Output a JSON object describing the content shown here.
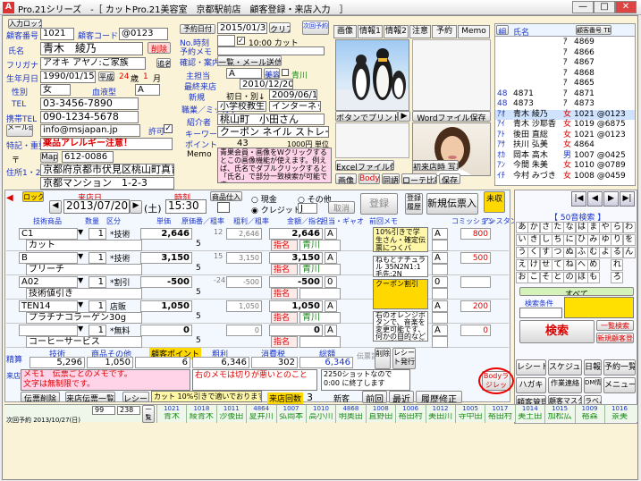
{
  "window": {
    "title": "Pro.21シリーズ　-［ カットPro.21美容室　京都駅前店　顧客登録・来店入力　］",
    "min": "—",
    "max": "□",
    "close": "✕"
  },
  "customer": {
    "lock": "入力ロック",
    "id_label": "顧客番号",
    "id": "1021",
    "code_label": "顧客コード",
    "code": "@0123",
    "name_label": "氏名",
    "name": "青木　綾乃",
    "delete": "削除",
    "furigana_label": "フリガナ",
    "furigana": "アオキ アヤノ:ご家族",
    "rename": "追名",
    "birth_label": "生年月日",
    "birth": "1990/01/15",
    "wareki": "平成",
    "age": "24",
    "age_unit": "歳",
    "month": "1",
    "month_unit": "月",
    "gender_label": "性別",
    "gender": "女",
    "blood_label": "血液型",
    "blood": "A",
    "tel_label": "TEL",
    "tel": "03-3456-7890",
    "mobile_label": "携帯TEL",
    "mobile": "090-1234-5678",
    "mail_label": "メール送信",
    "mail": "info@msjapan.jp",
    "permit": "許可",
    "note_label": "特記・重要",
    "note": "薬品アレルギー注意！",
    "zip_label": "〒",
    "map": "Map",
    "zip": "612-0086",
    "address_label": "住所1・2",
    "address1": "京都府京都市伏見区桃山町真育",
    "address2": "京都マンション　1-2-3"
  },
  "mid": {
    "reserve_label": "予約日付",
    "reserve_date": "2015/01/31",
    "clear": "クリア",
    "next_label": "次回予約",
    "next_reserve": "10:00 カット",
    "time_label": "No.時刻",
    "memo_label": "予約メモ",
    "confirm_label": "確認・案内",
    "confirm_btn": "一覧・メール送信",
    "staff_label": "主担当",
    "staff": "A",
    "staff_tag": "美容",
    "staff_name": "青川",
    "first_label": "最終来店",
    "first_date": "2010/12/20",
    "new_label": "新規",
    "first_visit": "初日・別↓",
    "first_visit_date": "2009/06/10",
    "job_label": "職業／ミッカケ",
    "job": "小学校教生",
    "route": "インターネット",
    "intro_label": "紹介者",
    "intro": "桃山町　小田さん",
    "keyword_label": "キーワード",
    "keyword": "クーポン ネイル ストレート",
    "point_label": "ポイント",
    "point": "43",
    "point_value": "1000円 単位",
    "memo_title": "Memo",
    "memo": "青果会員・画像をWクリックするとこの画像機能が使えます。例えば、氏名でダブルクリックすると「氏名」で部分一致検索が可能です"
  },
  "photos": {
    "tabs": [
      "画像",
      "情報1",
      "情報2",
      "注意",
      "予約",
      "Memo"
    ],
    "print_btn": "ボタンでプリント",
    "word_btn": "Wordファイル保存",
    "excel_btn": "Excelファイル保存",
    "shot_btn": "初来店時 写真",
    "image_btns": [
      "画像",
      "Body",
      "同語",
      "ローテ比較",
      "保存"
    ]
  },
  "list": {
    "header": [
      "組",
      "氏名",
      "顧客番号 TEL"
    ],
    "rows": [
      {
        "no": "",
        "name": "",
        "kana": "ｱ",
        "num": "4869"
      },
      {
        "no": "",
        "name": "",
        "kana": "ｱ",
        "num": "4866"
      },
      {
        "no": "",
        "name": "",
        "kana": "ｱ",
        "num": "4867"
      },
      {
        "no": "",
        "name": "",
        "kana": "ｱ",
        "num": "4868"
      },
      {
        "no": "",
        "name": "",
        "kana": "ｱ",
        "num": "4865"
      },
      {
        "no": "48",
        "name": "4871",
        "kana": "ｱ",
        "num": "4871"
      },
      {
        "no": "48",
        "name": "4873",
        "kana": "ｱ",
        "num": "4873"
      },
      {
        "no": "ｱｵ",
        "name": "青木 綾乃",
        "kana": "女",
        "num": "1021 @0123"
      },
      {
        "no": "ｱｲ",
        "name": "青木 沙耶香",
        "kana": "女",
        "num": "1019 @6875"
      },
      {
        "no": "ｱﾄ",
        "name": "後田 直総",
        "kana": "女",
        "num": "1021 @0123"
      },
      {
        "no": "ｱｻ",
        "name": "扶川 弘美",
        "kana": "女",
        "num": "4864"
      },
      {
        "no": "ｵｶ",
        "name": "岡本 高木",
        "kana": "男",
        "num": "1007 @0425"
      },
      {
        "no": "ｱﾝ",
        "name": "今間 朱美",
        "kana": "女",
        "num": "1010 @0789"
      },
      {
        "no": "ｲﾁ",
        "name": "今村 みづき",
        "kana": "女",
        "num": "1008 @0459"
      }
    ]
  },
  "visit": {
    "lock": "ロック中",
    "visit_label": "来店日",
    "date": "2013/07/20",
    "weekday": "(土)",
    "time_label": "時刻",
    "time": "15:30",
    "item_label": "商品仕入",
    "cash": "現金",
    "credit": "クレジット",
    "other": "その他",
    "other_val": "J",
    "cancel": "取消",
    "register": "登録",
    "history": "登録履歴",
    "new_slip": "新規伝票入力",
    "unpaid": "未収",
    "cols": [
      "技術商品",
      "数量",
      "区分",
      "単価",
      "原価番／粗率",
      "粗利／粗率",
      "金額／指名",
      "担当・ギャオ",
      "前回メモ",
      "コミッション",
      "アシスタント"
    ]
  },
  "lines": [
    {
      "code": "C1",
      "name": "カット",
      "qty": "1",
      "kind": "*技術",
      "price": "2,646",
      "cost": "5",
      "profit": "2,646",
      "amount": "2,646",
      "shimei": "A",
      "staff": "青川",
      "sub": "12",
      "comm": "800"
    },
    {
      "code": "B",
      "name": "ブリーチ",
      "qty": "1",
      "kind": "*技術",
      "price": "3,150",
      "cost": "5",
      "profit": "3,150",
      "amount": "3,150",
      "shimei": "A",
      "staff": "青川",
      "sub": "15",
      "comm": "500"
    },
    {
      "code": "A02",
      "name": "技術値引き",
      "qty": "1",
      "kind": "*割引",
      "price": "-500",
      "cost": "5",
      "profit": "-500",
      "amount": "-500",
      "shimei": "0",
      "staff": "",
      "sub": "-24",
      "comm": ""
    },
    {
      "code": "TEN14",
      "name": "プラチナコラーゲン30g",
      "qty": "1",
      "kind": "店販",
      "price": "1,050",
      "cost": "5",
      "profit": "1,050",
      "amount": "1,050",
      "shimei": "A",
      "staff": "青川",
      "sub": "",
      "comm": "200"
    },
    {
      "code": "",
      "name": "コーヒーサービス",
      "qty": "1",
      "kind": "*無料",
      "price": "0",
      "cost": "5",
      "profit": "0",
      "amount": "0",
      "shimei": "A",
      "staff": "",
      "sub": "",
      "comm": "0"
    }
  ],
  "memos": {
    "m1": "10%引きで学生さん・確定伝票につくバ",
    "m2": "ねもとナチュラル 35N2N1:1 毛先:2N",
    "m3": "クーポン割引",
    "m4": "右のオレンジボタンで、音楽を変更可能です、何かの目的などのご利用が...技術商品マスターにて設定可能です。"
  },
  "totals": {
    "label": "精算",
    "tech_label": "技術",
    "product_label": "商品その他",
    "point_label": "顧客ポイント",
    "profit_label": "粗利",
    "tax_label": "消費税",
    "total_label": "総額",
    "slip_label": "伝票計",
    "tech": "5,296",
    "product": "1,050",
    "point": "6",
    "profit": "6,346",
    "tax": "302",
    "total": "6,346",
    "cancel": "削除",
    "delivery": "レシート発行"
  },
  "notes": {
    "memo_label": "来店メモ",
    "memo1": "メモ1　伝票ごとのメモです。",
    "memo2": "文字は無制限です。",
    "memo3": "右のメモは切りが悪いとのこと",
    "memo4": "2250ショットなので 0:00 に終了します",
    "body_btn": "Bodyラジレット",
    "order_label": "伝票削除",
    "order_btn": "来店伝票一覧",
    "receipt_btn": "レシート",
    "coupon": "カット 10%引きで適いでおります。",
    "count_label": "来店回数",
    "count": "3",
    "new_label": "新客",
    "prev": "前回",
    "latest": "最近",
    "history": "履歴修正"
  },
  "bottom": {
    "label": "次回予約 2013/10/27(日)",
    "stat1": "99",
    "stat2": "238",
    "today": "一覧",
    "names_top": [
      "1021",
      "1018",
      "1011",
      "4864",
      "1007",
      "1010",
      "4868",
      "1008",
      "1006",
      "1012",
      "1005",
      "1017",
      "1014",
      "1015",
      "1009",
      "1016"
    ],
    "names": [
      "青木",
      "綾青木",
      "沙後田",
      "夏井川",
      "弘岡本",
      "高小川",
      "明奥田",
      "直野田",
      "裕田村",
      "美田川",
      "寺中田",
      "裕田村",
      "美土田",
      "加松広",
      "裕森",
      "景美"
    ]
  },
  "side": {
    "search_label": "50音検索",
    "nav": [
      "|◀",
      "◀",
      "▶",
      "▶|"
    ],
    "kana": [
      "あ",
      "か",
      "さ",
      "た",
      "な",
      "は",
      "ま",
      "や",
      "ら",
      "わ",
      "い",
      "き",
      "し",
      "ち",
      "に",
      "ひ",
      "み",
      "ゆ",
      "り",
      "を",
      "う",
      "く",
      "す",
      "つ",
      "ぬ",
      "ふ",
      "む",
      "よ",
      "る",
      "ん",
      "え",
      "け",
      "せ",
      "て",
      "ね",
      "へ",
      "め",
      "",
      "れ",
      "",
      "お",
      "こ",
      "そ",
      "と",
      "の",
      "ほ",
      "も",
      "",
      "ろ",
      ""
    ],
    "all": "すべて",
    "cond": "検索条件",
    "search": "検索",
    "list_btn": "一覧検索",
    "new_btn": "新規顧客登録",
    "bottom_btns": [
      "レシート",
      "スケジュール",
      "日報",
      "予約一覧",
      "ハガキ",
      "作業連絡",
      "DM情報",
      "メニュー",
      "顧客管理",
      "顧客マスタ",
      "ラベル"
    ]
  },
  "colors": {
    "accent": "#1a34c8",
    "alert": "#d00",
    "memo": "#ffd3e8",
    "yellow": "#fff7a8"
  }
}
